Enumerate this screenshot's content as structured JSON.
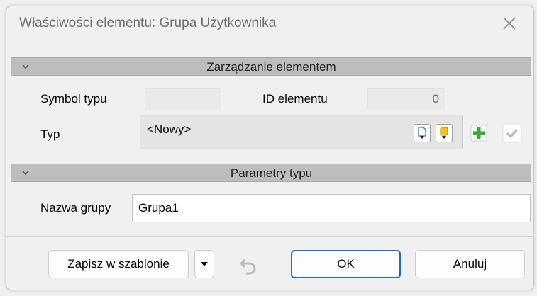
{
  "window": {
    "title": "Właściwości elementu: Grupa Użytkownika"
  },
  "section_management": {
    "label": "Zarządzanie elementem"
  },
  "fields": {
    "type_symbol_label": "Symbol typu",
    "type_symbol_value": "",
    "element_id_label": "ID elementu",
    "element_id_value": "0",
    "type_label": "Typ",
    "type_value": "<Nowy>"
  },
  "section_params": {
    "label": "Parametry typu"
  },
  "group_name": {
    "label": "Nazwa grupy",
    "value": "Grupa1"
  },
  "footer": {
    "save_template_label": "Zapisz w szablonie",
    "ok_label": "OK",
    "cancel_label": "Anuluj"
  },
  "colors": {
    "accent": "#1c6fd0",
    "add_green": "#2fae2f",
    "header_gray": "#bdbdbd"
  },
  "icons": [
    "close-icon",
    "chevron-down-icon",
    "new-document-icon",
    "database-icon",
    "plus-icon",
    "checkmark-icon",
    "undo-icon",
    "dropdown-arrow-icon"
  ]
}
